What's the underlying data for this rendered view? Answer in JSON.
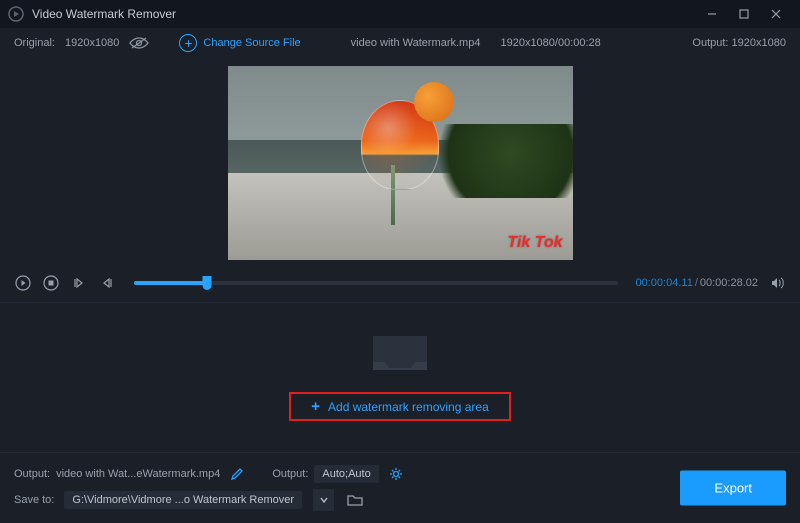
{
  "titlebar": {
    "title": "Video Watermark Remover"
  },
  "infobar": {
    "original_label": "Original:",
    "original_dim": "1920x1080",
    "change_source": "Change Source File",
    "filename": "video with Watermark.mp4",
    "file_dim_dur": "1920x1080/00:00:28",
    "output_label": "Output:",
    "output_dim": "1920x1080"
  },
  "preview": {
    "watermark_text": "Tik Tok"
  },
  "playback": {
    "current_time": "00:00:04.11",
    "duration": "00:00:28.02"
  },
  "dropzone": {
    "add_area": "Add watermark removing area"
  },
  "bottom": {
    "output_label": "Output:",
    "output_filename": "video with Wat...eWatermark.mp4",
    "output2_label": "Output:",
    "output_format": "Auto;Auto",
    "save_to_label": "Save to:",
    "save_to_path": "G:\\Vidmore\\Vidmore ...o Watermark Remover",
    "export": "Export"
  }
}
